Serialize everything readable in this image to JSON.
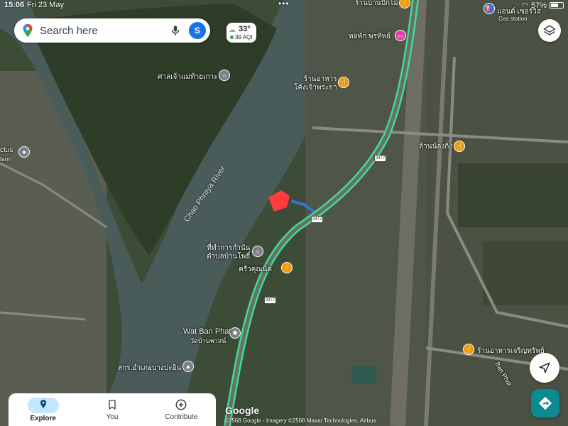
{
  "status_bar": {
    "time": "15:06",
    "date": "Fri 23 May",
    "battery": "57%"
  },
  "search": {
    "placeholder": "Search here",
    "avatar_initial": "S"
  },
  "weather": {
    "temp": "33°",
    "aqi": "39 AQI"
  },
  "map": {
    "river_label": "Chao Phraya River",
    "labels": [
      {
        "id": "shrine",
        "text": "ศาลเจ้าแม่ท้ายเกาะ"
      },
      {
        "id": "restaurant-khongjaophraya",
        "text": "ร้านอาหาร\nโค้งเจ้าพระยา"
      },
      {
        "id": "bakery",
        "text": "ร้านบ้านปักไม้"
      },
      {
        "id": "dorm",
        "text": "หอพัก พรทิพย์"
      },
      {
        "id": "gas-station-name",
        "text": "แอนด์ เซอร์วิส"
      },
      {
        "id": "gas-station-type",
        "text": "Gas station"
      },
      {
        "id": "lan-nong-king",
        "text": "ล้านน้องกิ่ง"
      },
      {
        "id": "district-office",
        "text": "ที่ทำการกำนัน\nตำบลบ้านโพธิ์"
      },
      {
        "id": "kitchen",
        "text": "ครัวคุณนิด"
      },
      {
        "id": "wat-ban-phat",
        "text": "Wat Ban Phat"
      },
      {
        "id": "wat-ban-phat-thai",
        "text": "วัดบ้านพาสน์"
      },
      {
        "id": "cooperative",
        "text": "สกร.อำเภอบางปะอิน"
      },
      {
        "id": "restaurant-charoensap",
        "text": "ร้านอาหารเจริญทรัพย์"
      },
      {
        "id": "ban-phat-road",
        "text": "Ban Phat"
      },
      {
        "id": "cactus-farm",
        "text": "ctus"
      },
      {
        "id": "cactus-farm-sub",
        "text": "farm"
      }
    ],
    "route_numbers": [
      "3477",
      "3477",
      "3477"
    ]
  },
  "bottom_nav": {
    "items": [
      {
        "label": "Explore",
        "active": true
      },
      {
        "label": "You",
        "active": false
      },
      {
        "label": "Contribute",
        "active": false
      }
    ]
  },
  "footer": {
    "logo": "Google",
    "attribution": "©2568 Google - Imagery ©2568 Maxar Technologies, Airbus"
  },
  "colors": {
    "route_highlight": "#3ddc97",
    "accent_blue": "#1a73e8",
    "directions_teal": "#0b8a8f",
    "poi_food": "#f29900",
    "selected_area": "#ff3b3b"
  },
  "icons": [
    "google-maps-pin-icon",
    "mic-icon",
    "layers-icon",
    "locate-arrow-icon",
    "directions-icon",
    "explore-pin-icon",
    "bookmark-icon",
    "add-circle-icon",
    "food-icon",
    "landmark-icon",
    "gas-station-icon"
  ]
}
